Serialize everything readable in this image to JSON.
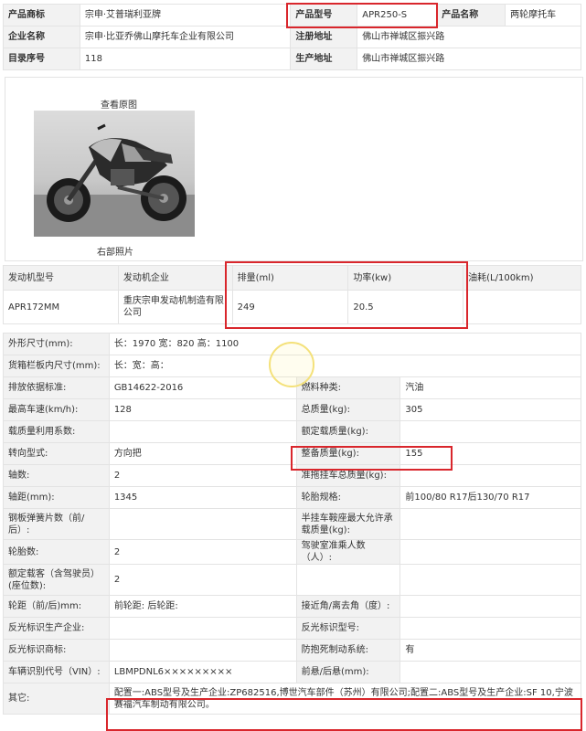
{
  "top": {
    "rows": [
      [
        {
          "label": "产品商标",
          "value": "宗申·艾普瑞利亚牌"
        },
        {
          "label": "产品型号",
          "value": "APR250-S"
        },
        {
          "label": "产品名称",
          "value": "两轮摩托车"
        }
      ],
      [
        {
          "label": "企业名称",
          "value": "宗申·比亚乔佛山摩托车企业有限公司"
        },
        {
          "label": "注册地址",
          "value": "佛山市禅城区振兴路"
        }
      ],
      [
        {
          "label": "目录序号",
          "value": "118"
        },
        {
          "label": "生产地址",
          "value": "佛山市禅城区振兴路"
        }
      ]
    ]
  },
  "photo": {
    "title": "查看原图",
    "caption": "右部照片"
  },
  "engine": {
    "headers": [
      "发动机型号",
      "发动机企业",
      "排量(ml)",
      "功率(kw)",
      "油耗(L/100km)"
    ],
    "row": [
      "APR172MM",
      "重庆宗申发动机制造有限公司",
      "249",
      "20.5",
      ""
    ]
  },
  "specs": {
    "rows": [
      {
        "l1": "外形尺寸(mm):",
        "v1": "长：1970 宽：820 高：1100",
        "l2": "",
        "v2": "",
        "span": true
      },
      {
        "l1": "货箱栏板内尺寸(mm):",
        "v1": "长：宽：高：",
        "l2": "",
        "v2": "",
        "span": true
      },
      {
        "l1": "排放依据标准:",
        "v1": "GB14622-2016",
        "l2": "燃料种类:",
        "v2": "汽油"
      },
      {
        "l1": "最高车速(km/h):",
        "v1": "128",
        "l2": "总质量(kg):",
        "v2": "305"
      },
      {
        "l1": "载质量利用系数:",
        "v1": "",
        "l2": "额定载质量(kg):",
        "v2": ""
      },
      {
        "l1": "转向型式:",
        "v1": "方向把",
        "l2": "整备质量(kg):",
        "v2": "155"
      },
      {
        "l1": "轴数:",
        "v1": "2",
        "l2": "准拖挂车总质量(kg):",
        "v2": ""
      },
      {
        "l1": "轴距(mm):",
        "v1": "1345",
        "l2": "轮胎规格:",
        "v2": "前100/80 R17后130/70 R17"
      },
      {
        "l1": "钢板弹簧片数（前/后）:",
        "v1": "",
        "l2": "半挂车鞍座最大允许承载质量(kg):",
        "v2": ""
      },
      {
        "l1": "轮胎数:",
        "v1": "2",
        "l2": "驾驶室准乘人数（人）:",
        "v2": ""
      },
      {
        "l1": "额定载客（含驾驶员）(座位数):",
        "v1": "2",
        "l2": "",
        "v2": ""
      },
      {
        "l1": "轮距（前/后)mm:",
        "v1": "前轮距: 后轮距:",
        "l2": "接近角/离去角（度）:",
        "v2": ""
      },
      {
        "l1": "反光标识生产企业:",
        "v1": "",
        "l2": "反光标识型号:",
        "v2": ""
      },
      {
        "l1": "反光标识商标:",
        "v1": "",
        "l2": "防抱死制动系统:",
        "v2": "有"
      },
      {
        "l1": "车辆识别代号（VIN）:",
        "v1": "LBMPDNL6×××××××××",
        "l2": "前悬/后悬(mm):",
        "v2": ""
      },
      {
        "l1": "其它:",
        "v1": "配置一:ABS型号及生产企业:ZP682516,博世汽车部件（苏州）有限公司;配置二:ABS型号及生产企业:SF 10,宁波赛福汽车制动有限公司。",
        "l2": "",
        "v2": "",
        "span": true
      }
    ]
  },
  "colors": {
    "highlight": "#d9262c",
    "label_bg": "#f2f2f2"
  }
}
